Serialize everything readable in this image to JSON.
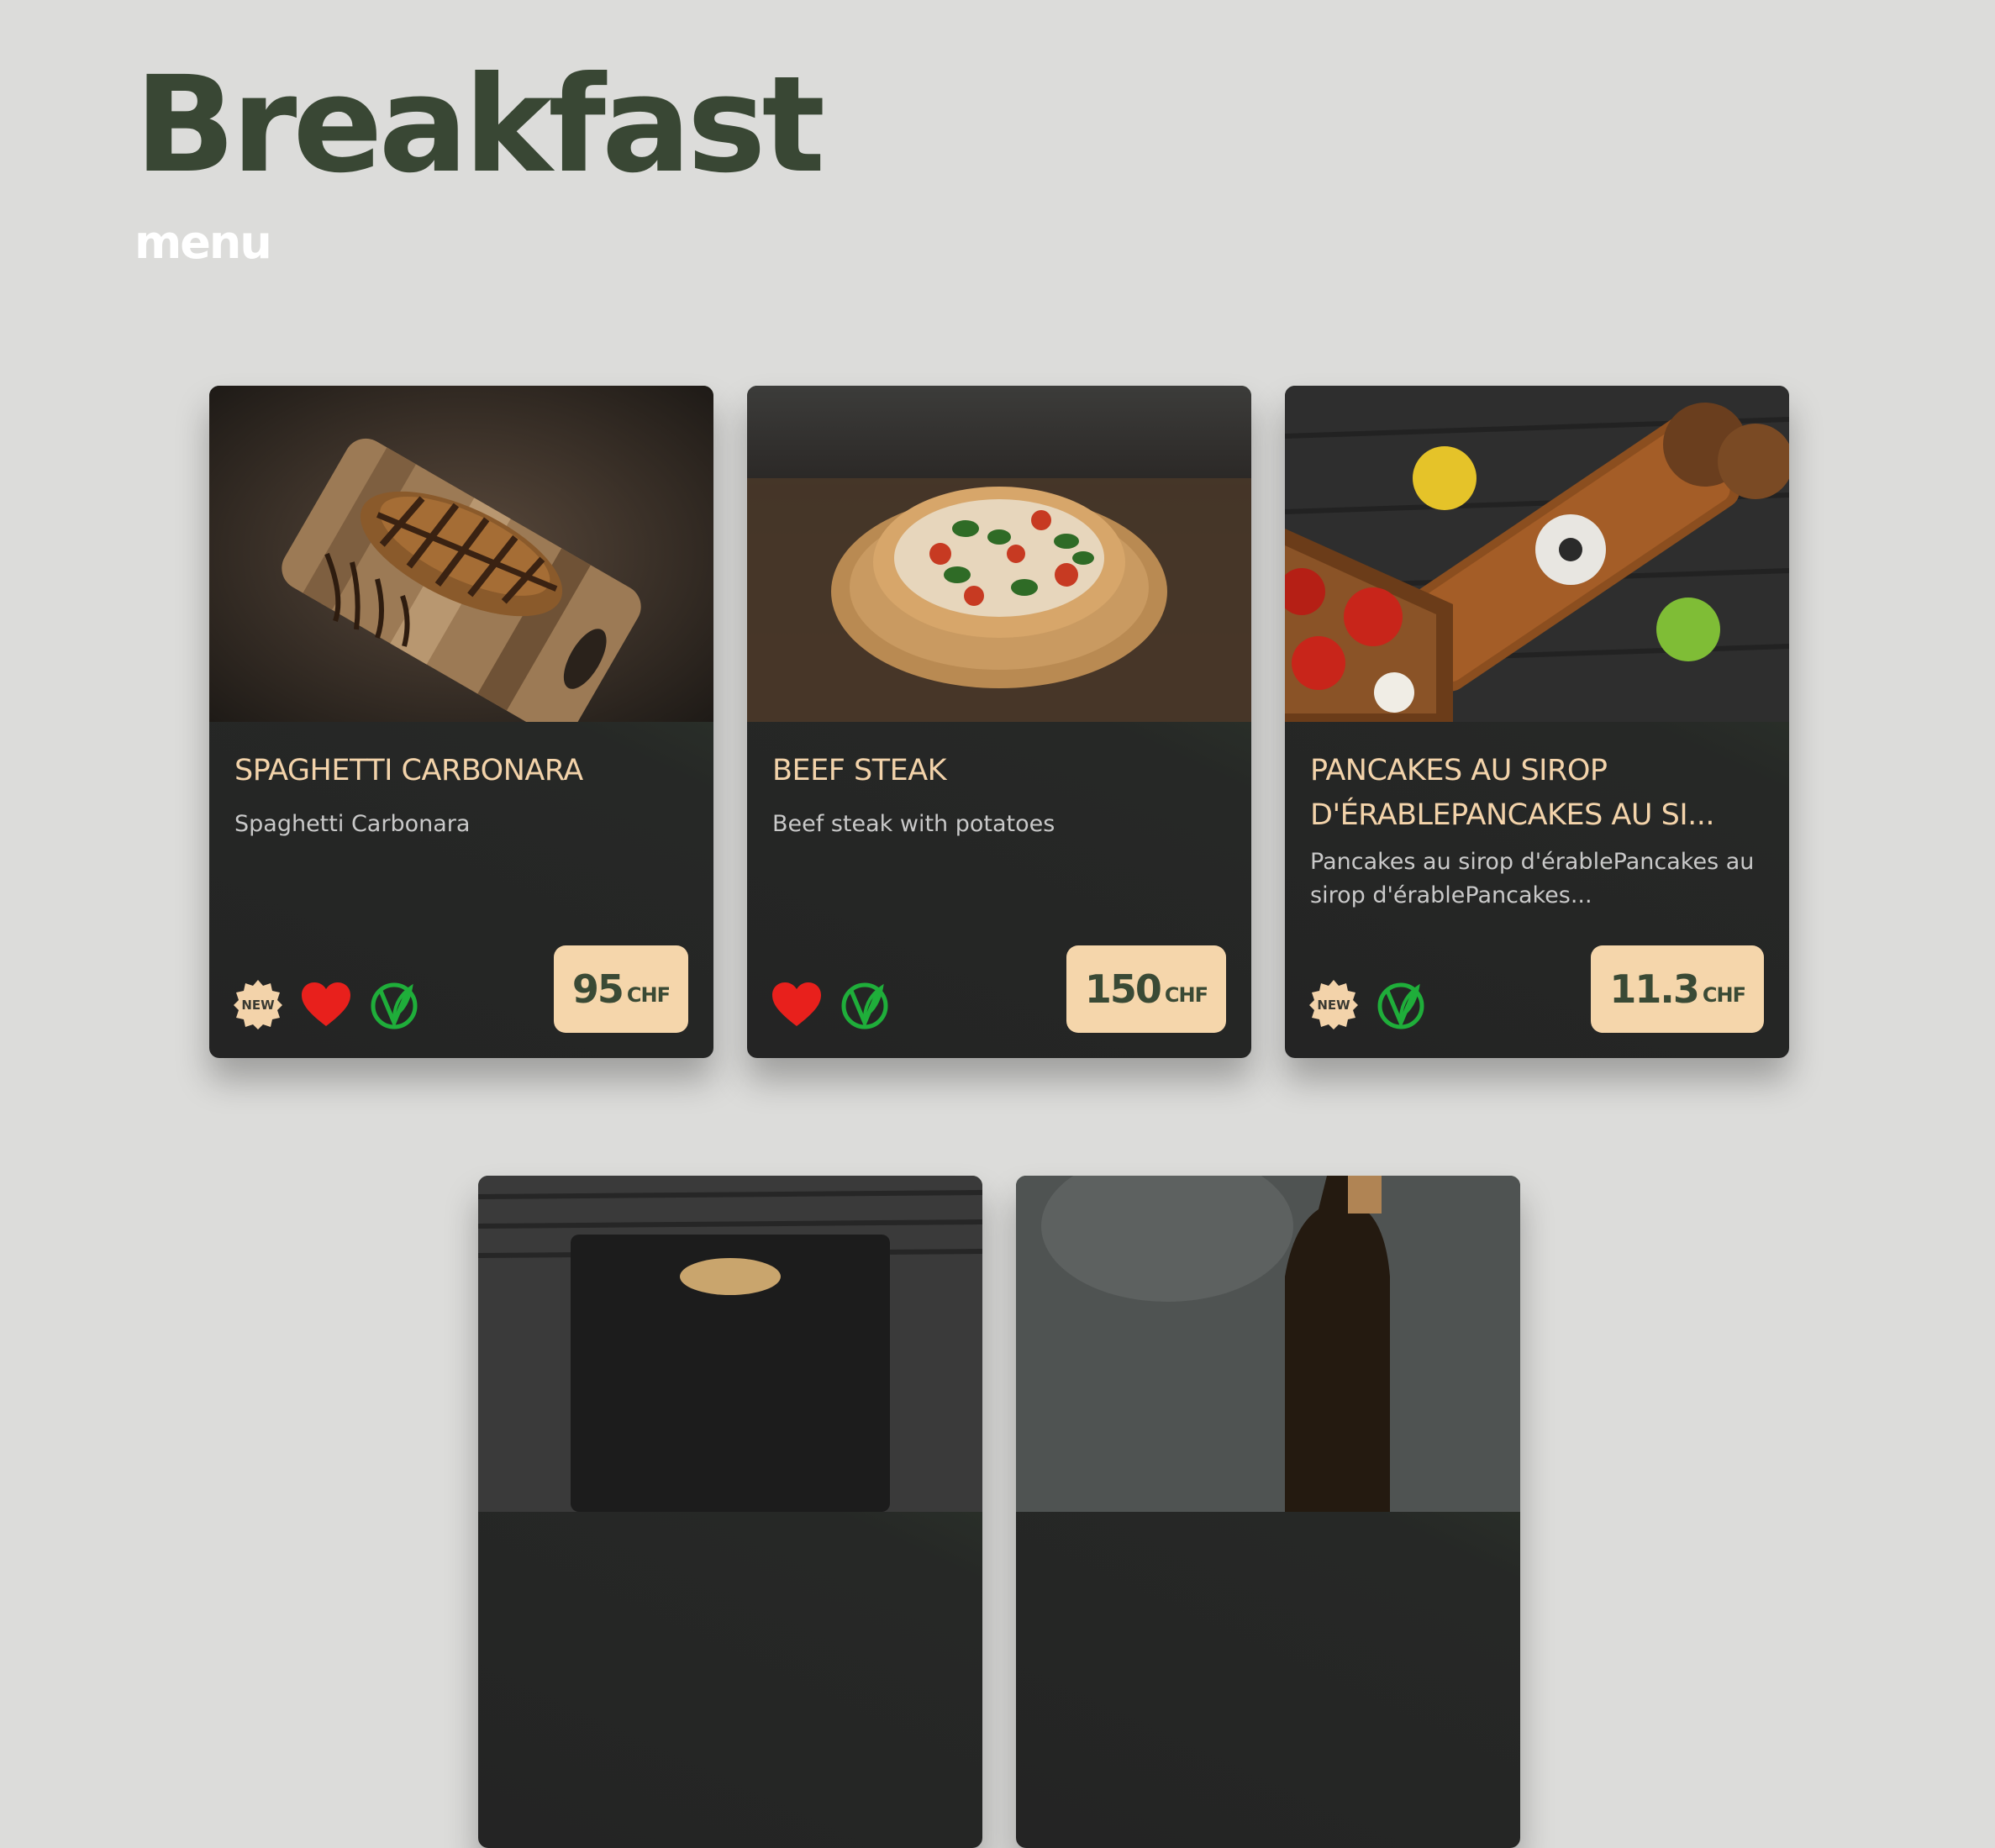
{
  "header": {
    "title": "Breakfast",
    "subtitle": "menu"
  },
  "cards": [
    {
      "name": "SPAGHETTI CARBONARA",
      "description": "Spaghetti Carbonara",
      "price": "95",
      "currency": "CHF",
      "badges": [
        "new-badge-icon",
        "heart-icon",
        "vegan-icon"
      ]
    },
    {
      "name": "BEEF STEAK",
      "description": "Beef steak with potatoes",
      "price": "150",
      "currency": "CHF",
      "badges": [
        "heart-icon",
        "vegan-icon"
      ]
    },
    {
      "name": "PANCAKES AU SIROP D'ÉRABLEPANCAKES AU SI...",
      "description": "Pancakes au sirop d'érablePancakes au sirop d'érablePancakes...",
      "price": "11.3",
      "currency": "CHF",
      "badges": [
        "new-badge-icon",
        "vegan-icon"
      ]
    }
  ],
  "badge_text": {
    "new": "NEW"
  },
  "colors": {
    "title": "#394734",
    "card_name": "#f3d3aa",
    "price_bg": "#f5d6ab",
    "heart": "#e8201c",
    "vegan": "#1fae3a"
  }
}
